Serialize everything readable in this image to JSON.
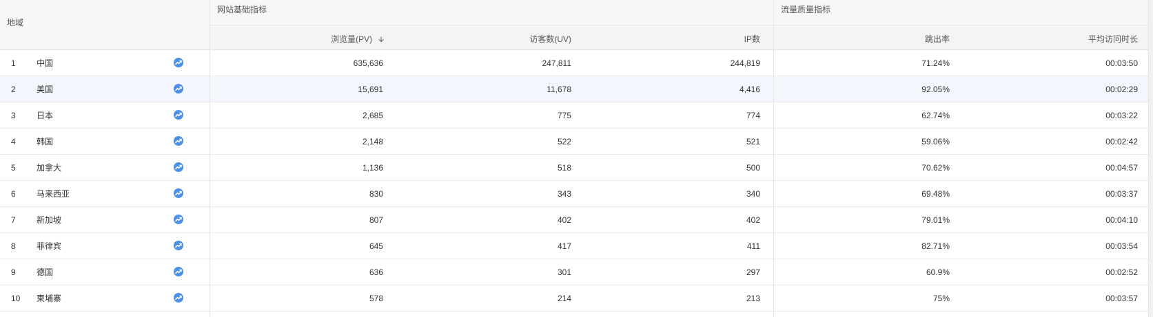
{
  "headers": {
    "region": "地域",
    "group_basic": "网站基础指标",
    "group_quality": "流量质量指标",
    "pv": "浏览量(PV)",
    "uv": "访客数(UV)",
    "ip": "IP数",
    "bounce": "跳出率",
    "avg_time": "平均访问时长"
  },
  "sort": {
    "column": "pv",
    "direction": "desc",
    "icon": "arrow-down-icon",
    "glyph": "🡫"
  },
  "colors": {
    "trend_icon": "#4d90e6",
    "highlight_row": "#f3f7fd"
  },
  "rows": [
    {
      "rank": "1",
      "region": "中国",
      "pv": "635,636",
      "uv": "247,811",
      "ip": "244,819",
      "bounce": "71.24%",
      "avg_time": "00:03:50"
    },
    {
      "rank": "2",
      "region": "美国",
      "pv": "15,691",
      "uv": "11,678",
      "ip": "4,416",
      "bounce": "92.05%",
      "avg_time": "00:02:29"
    },
    {
      "rank": "3",
      "region": "日本",
      "pv": "2,685",
      "uv": "775",
      "ip": "774",
      "bounce": "62.74%",
      "avg_time": "00:03:22"
    },
    {
      "rank": "4",
      "region": "韩国",
      "pv": "2,148",
      "uv": "522",
      "ip": "521",
      "bounce": "59.06%",
      "avg_time": "00:02:42"
    },
    {
      "rank": "5",
      "region": "加拿大",
      "pv": "1,136",
      "uv": "518",
      "ip": "500",
      "bounce": "70.62%",
      "avg_time": "00:04:57"
    },
    {
      "rank": "6",
      "region": "马来西亚",
      "pv": "830",
      "uv": "343",
      "ip": "340",
      "bounce": "69.48%",
      "avg_time": "00:03:37"
    },
    {
      "rank": "7",
      "region": "新加坡",
      "pv": "807",
      "uv": "402",
      "ip": "402",
      "bounce": "79.01%",
      "avg_time": "00:04:10"
    },
    {
      "rank": "8",
      "region": "菲律宾",
      "pv": "645",
      "uv": "417",
      "ip": "411",
      "bounce": "82.71%",
      "avg_time": "00:03:54"
    },
    {
      "rank": "9",
      "region": "德国",
      "pv": "636",
      "uv": "301",
      "ip": "297",
      "bounce": "60.9%",
      "avg_time": "00:02:52"
    },
    {
      "rank": "10",
      "region": "柬埔寨",
      "pv": "578",
      "uv": "214",
      "ip": "213",
      "bounce": "75%",
      "avg_time": "00:03:57"
    }
  ]
}
